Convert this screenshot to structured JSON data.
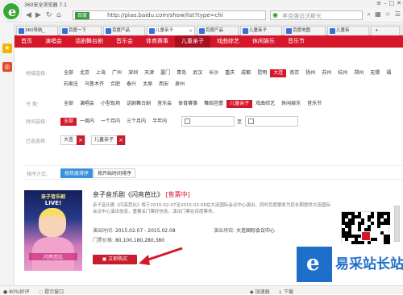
{
  "browser": {
    "title": "360安全浏览器 7.1",
    "window_buttons": [
      "≡",
      "–",
      "□",
      "✕"
    ],
    "security_badge": "百度",
    "url": "http://piao.baidu.com/show/list?type=chi",
    "search_placeholder": "李克强访沃斯长",
    "tabs": [
      {
        "label": "360导航_",
        "active": false
      },
      {
        "label": "百度一下",
        "active": false
      },
      {
        "label": "百度产品",
        "active": false
      },
      {
        "label": "儿童亲子",
        "active": true
      },
      {
        "label": "百度产品",
        "active": false
      },
      {
        "label": "儿童亲子",
        "active": false
      },
      {
        "label": "百度地图",
        "active": false
      },
      {
        "label": "儿童亲",
        "active": false
      }
    ]
  },
  "site_nav": {
    "items": [
      "首页",
      "演唱会",
      "话剧舞台剧",
      "音乐会",
      "体育赛事",
      "儿童亲子",
      "戏曲综艺",
      "休闲娱乐",
      "音乐节"
    ],
    "active_index": 5
  },
  "filters": {
    "region": {
      "label": "地域选择:",
      "options_row1": [
        "全部",
        "北京",
        "上海",
        "广州",
        "深圳",
        "天津",
        "厦门",
        "青岛",
        "武汉",
        "长沙",
        "重庆",
        "成都",
        "昆明",
        "大连",
        "南京",
        "扬州",
        "苏州",
        "杭州",
        "郑州",
        "无锡",
        "福"
      ],
      "options_row2": [
        "石家庄",
        "乌鲁木齐",
        "合肥",
        "泰兴",
        "太原",
        "西安",
        "泉州"
      ],
      "selected": "大连"
    },
    "category": {
      "label": "分   类:",
      "options": [
        "全部",
        "演唱会",
        "小型现场",
        "话剧舞台剧",
        "音乐会",
        "体育赛事",
        "舞蹈芭蕾",
        "儿童亲子",
        "戏曲综艺",
        "休闲娱乐",
        "音乐节"
      ],
      "selected": "儿童亲子"
    },
    "time": {
      "label": "时间选择:",
      "options": [
        "全部",
        "一周内",
        "一个月内",
        "三个月内",
        "半年内"
      ],
      "selected": "全部",
      "date_separator": "至"
    },
    "chosen": {
      "label": "已选选择:",
      "tags": [
        "大连",
        "儿童亲子"
      ]
    }
  },
  "sort": {
    "label": "排序方式:",
    "buttons": [
      "按热度排序",
      "按开始时间排序"
    ],
    "selected": "按热度排序"
  },
  "listing": {
    "poster": {
      "title": "亲子音乐剧",
      "live": "LIVE!",
      "name": "闪亮芭比"
    },
    "title": "亲子音乐剧《闪亮芭比》",
    "status": "[售票中]",
    "description": "亲子音乐剧《闪亮芭比》将于2015-02-07至2015-02-08在大连国际会议中心演出，同时百度票务为您长期提供大连国际会议中心演出信息，重要关门票好信息，演出门票在百度票务。",
    "time_label": "演出时间:",
    "time_value": "2015.02.07 - 2015.02.08",
    "venue_label": "演出场馆:",
    "venue_value": "大连国际会议中心",
    "price_label": "门票价格:",
    "price_value": "80,100,180,280,380",
    "buy_button": "立即购买"
  },
  "statusbar": {
    "zoom": "80%好评",
    "speed": "提示窗口",
    "accelerate": "加速器",
    "download": "下载"
  },
  "watermark": {
    "logo_letter": "e",
    "text": "易采站长站"
  },
  "colors": {
    "brand_red": "#d6162b",
    "sort_blue": "#3a8fdc",
    "browser_green": "#3aa63a",
    "watermark_blue": "#1e6fc9"
  }
}
